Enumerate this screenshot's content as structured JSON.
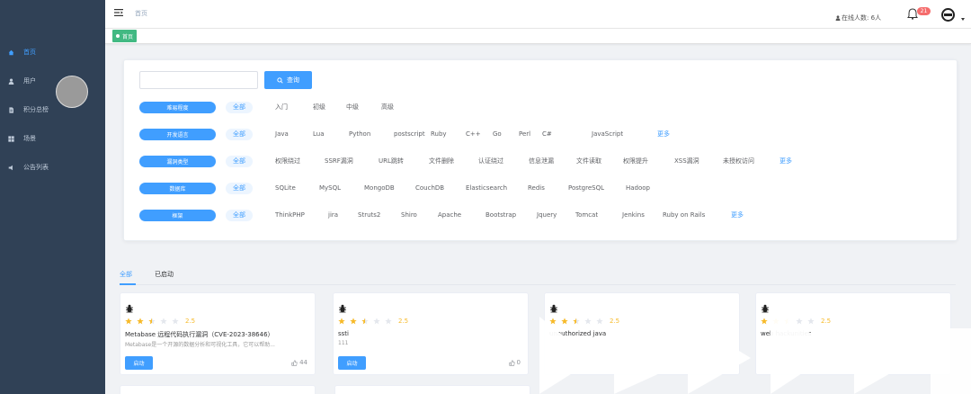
{
  "sidebar": {
    "items": [
      {
        "label": "首页",
        "icon": "home-icon"
      },
      {
        "label": "用户",
        "icon": "user-icon"
      },
      {
        "label": "积分总榜",
        "icon": "document-icon"
      },
      {
        "label": "场景",
        "icon": "grid-icon"
      },
      {
        "label": "公告列表",
        "icon": "speaker-icon"
      }
    ]
  },
  "header": {
    "breadcrumb": "首页",
    "online_label": "在线人数: 6人",
    "notification_count": "21"
  },
  "tags_view": {
    "active_tag": "首页"
  },
  "search": {
    "button_label": "查询",
    "placeholder": ""
  },
  "filters": [
    {
      "label": "难易程度",
      "options": [
        "全部",
        "入门",
        "初级",
        "中级",
        "高级"
      ],
      "more": ""
    },
    {
      "label": "开发语言",
      "options": [
        "全部",
        "Java",
        "Lua",
        "Python",
        "postscript",
        "Ruby",
        "C++",
        "Go",
        "Perl",
        "C#",
        "JavaScript"
      ],
      "more": "更多"
    },
    {
      "label": "漏洞类型",
      "options": [
        "全部",
        "权限绕过",
        "SSRF漏洞",
        "URL跳转",
        "文件删除",
        "认证绕过",
        "信息泄漏",
        "文件读取",
        "权限提升",
        "XSS漏洞",
        "未授权访问"
      ],
      "more": "更多"
    },
    {
      "label": "数据库",
      "options": [
        "全部",
        "SQLite",
        "MySQL",
        "MongoDB",
        "CouchDB",
        "Elasticsearch",
        "Redis",
        "PostgreSQL",
        "Hadoop"
      ],
      "more": ""
    },
    {
      "label": "框架",
      "options": [
        "全部",
        "ThinkPHP",
        "jira",
        "Struts2",
        "Shiro",
        "Apache",
        "Bootstrap",
        "Jquery",
        "Tomcat",
        "Jenkins",
        "Ruby on Rails"
      ],
      "more": "更多"
    }
  ],
  "tabs": {
    "all": "全部",
    "started": "已启动"
  },
  "cards": [
    {
      "rating": 2.5,
      "score_text": "2.5",
      "title": "Metabase 远程代码执行漏洞（CVE-2023-38646）",
      "desc": "Metabase是一个开源的数据分析和可视化工具，它可以帮助...",
      "button": "启动",
      "count": "44"
    },
    {
      "rating": 2.5,
      "score_text": "2.5",
      "title": "ssti",
      "desc": "111",
      "button": "启动",
      "count": "0"
    },
    {
      "rating": 2.5,
      "score_text": "2.5",
      "title": "unauthorized java",
      "desc": "",
      "button": "",
      "count": ""
    },
    {
      "rating": 2.5,
      "score_text": "2.5",
      "title": "web hackunities",
      "desc": "",
      "button": "",
      "count": ""
    }
  ],
  "colors": {
    "sidebar_bg": "#304156",
    "primary": "#409eff",
    "tag_green": "#42b983",
    "badge_red": "#f56c6c",
    "star": "#f7ba2a"
  }
}
